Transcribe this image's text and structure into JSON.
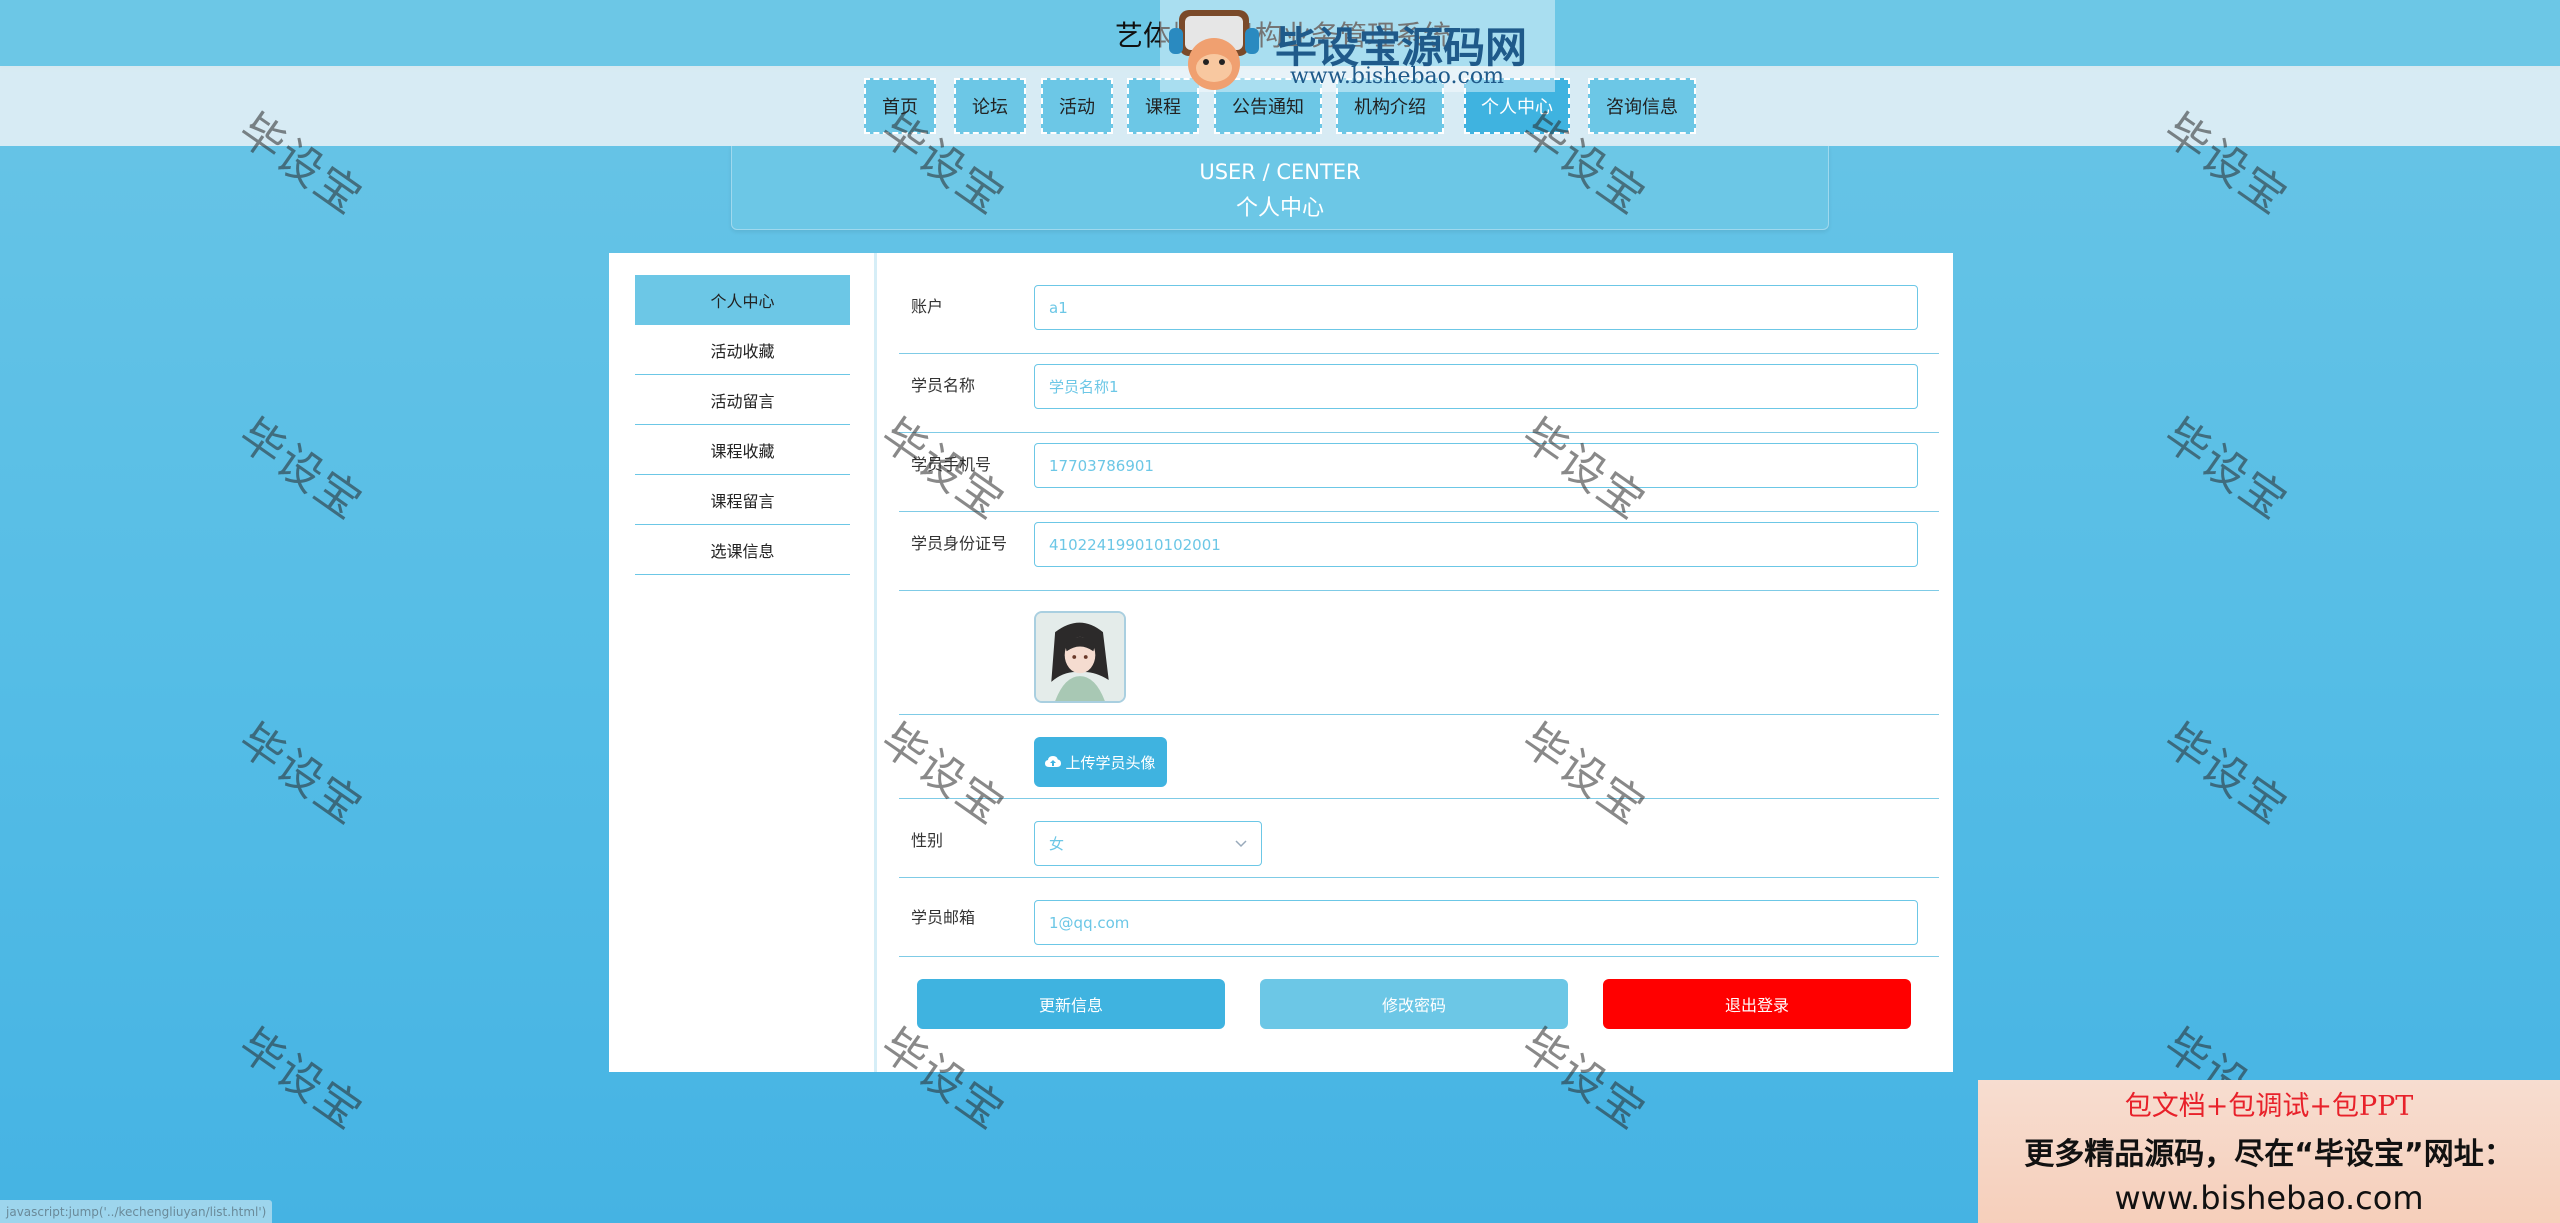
{
  "header": {
    "site_title": "艺体培训机构业务管理系统",
    "logo_text": "毕设宝源码网",
    "logo_url": "www.bishebao.com"
  },
  "nav": [
    {
      "label": "首页",
      "active": false
    },
    {
      "label": "论坛",
      "active": false
    },
    {
      "label": "活动",
      "active": false
    },
    {
      "label": "课程",
      "active": false
    },
    {
      "label": "公告通知",
      "active": false
    },
    {
      "label": "机构介绍",
      "active": false
    },
    {
      "label": "个人中心",
      "active": true
    },
    {
      "label": "咨询信息",
      "active": false
    }
  ],
  "page_head": {
    "en": "USER / CENTER",
    "zh": "个人中心"
  },
  "sidebar": {
    "items": [
      {
        "label": "个人中心",
        "active": true
      },
      {
        "label": "活动收藏",
        "active": false
      },
      {
        "label": "活动留言",
        "active": false
      },
      {
        "label": "课程收藏",
        "active": false
      },
      {
        "label": "课程留言",
        "active": false
      },
      {
        "label": "选课信息",
        "active": false
      }
    ]
  },
  "form": {
    "account": {
      "label": "账户",
      "value": "a1"
    },
    "name": {
      "label": "学员名称",
      "value": "学员名称1"
    },
    "phone": {
      "label": "学员手机号",
      "value": "17703786901"
    },
    "id_card": {
      "label": "学员身份证号",
      "value": "410224199010102001"
    },
    "upload_label": "上传学员头像",
    "gender": {
      "label": "性别",
      "value": "女"
    },
    "email": {
      "label": "学员邮箱",
      "value": "1@qq.com"
    }
  },
  "buttons": {
    "update": "更新信息",
    "change_password": "修改密码",
    "logout": "退出登录"
  },
  "colors": {
    "primary": "#3fb3e0",
    "secondary": "#6cc7e6",
    "danger": "#ff0000"
  },
  "watermark": "毕设宝",
  "promo": {
    "line1": "包文档+包调试+包PPT",
    "line2": "更多精品源码，尽在“毕设宝”网址：",
    "line3": "www.bishebao.com"
  },
  "status_url": "javascript:jump('../kechengliuyan/list.html')"
}
